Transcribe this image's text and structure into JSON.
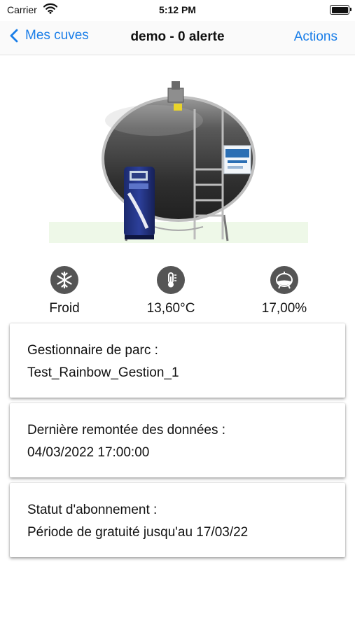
{
  "status_bar": {
    "carrier": "Carrier",
    "time": "5:12 PM"
  },
  "nav": {
    "back_label": "Mes cuves",
    "title": "demo - 0 alerte",
    "action_label": "Actions"
  },
  "colors": {
    "accent": "#1a7ee8",
    "icon_bg": "#555555"
  },
  "metrics": [
    {
      "icon": "snowflake-icon",
      "label": "Froid"
    },
    {
      "icon": "thermometer-icon",
      "label": "13,60°C"
    },
    {
      "icon": "tank-level-icon",
      "label": "17,00%"
    }
  ],
  "cards": [
    {
      "title": "Gestionnaire de parc :",
      "value": "Test_Rainbow_Gestion_1"
    },
    {
      "title": "Dernière remontée des données :",
      "value": "04/03/2022 17:00:00"
    },
    {
      "title": "Statut d'abonnement :",
      "value": "Période de gratuité jusqu'au 17/03/22"
    }
  ]
}
